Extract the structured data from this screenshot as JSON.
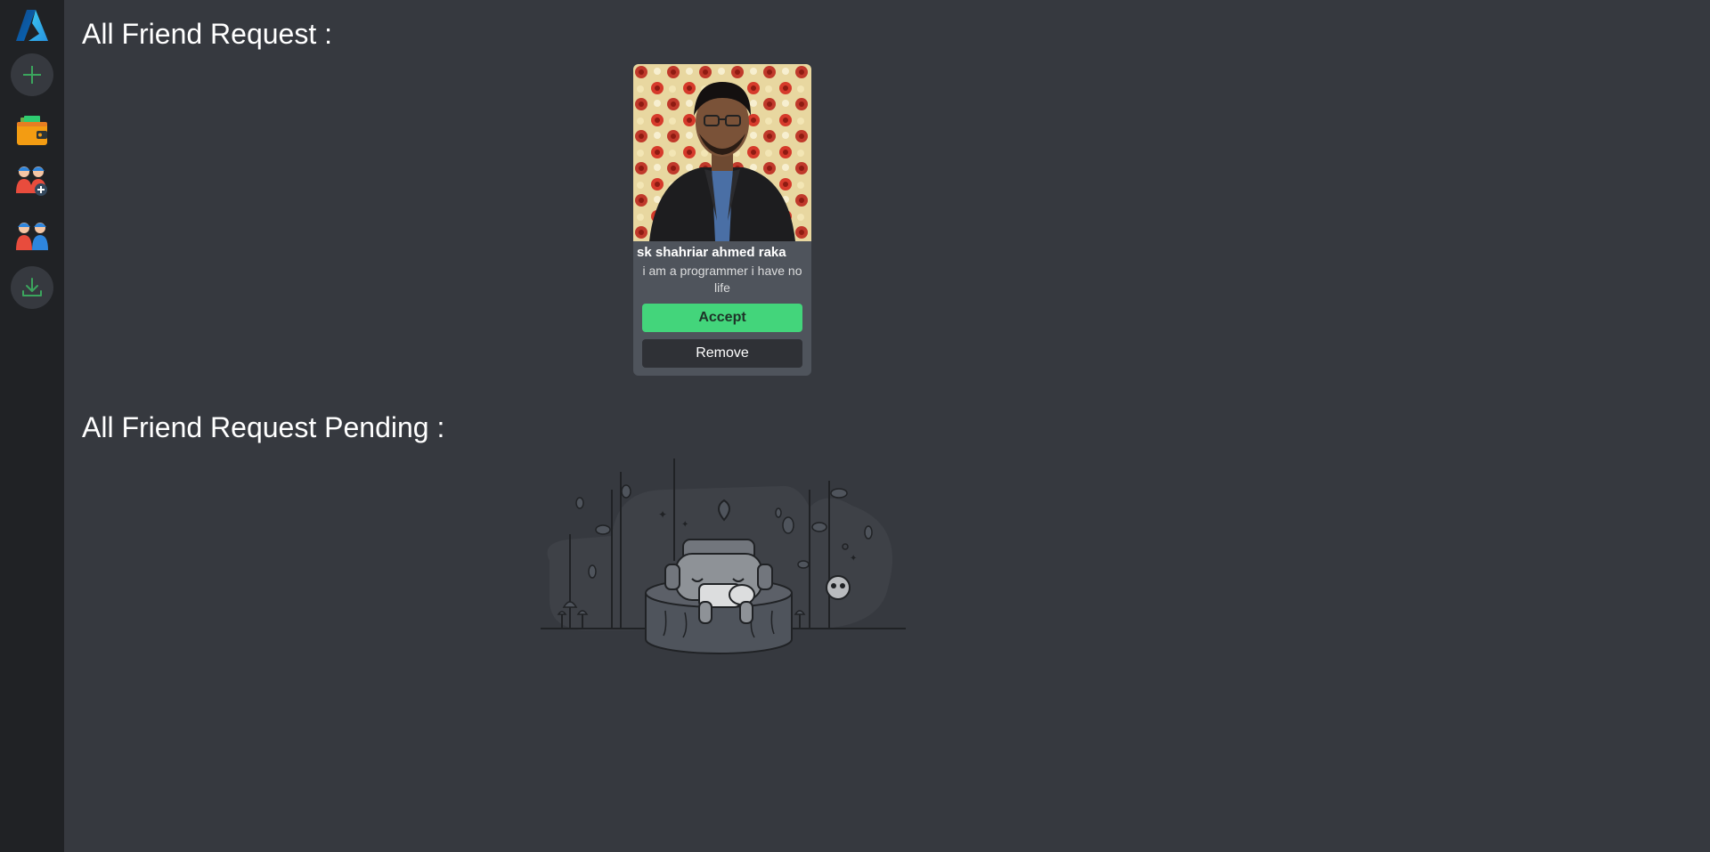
{
  "sidebar": {
    "items": [
      {
        "icon": "azure-logo-icon"
      },
      {
        "icon": "plus-icon"
      },
      {
        "icon": "wallet-icon"
      },
      {
        "icon": "add-friend-icon"
      },
      {
        "icon": "friends-icon"
      },
      {
        "icon": "download-icon"
      }
    ],
    "accent": "#3ba55d"
  },
  "requests": {
    "title": "All Friend Request :",
    "cards": [
      {
        "name": "sk shahriar ahmed raka",
        "bio": "i am a programmer i have no life",
        "accept_label": "Accept",
        "remove_label": "Remove"
      }
    ]
  },
  "pending": {
    "title": "All Friend Request Pending :",
    "empty_icon": "empty-state-illustration"
  },
  "colors": {
    "background": "#36393f",
    "sidebar": "#202225",
    "card": "#4f545c",
    "accept": "#43d57b"
  }
}
